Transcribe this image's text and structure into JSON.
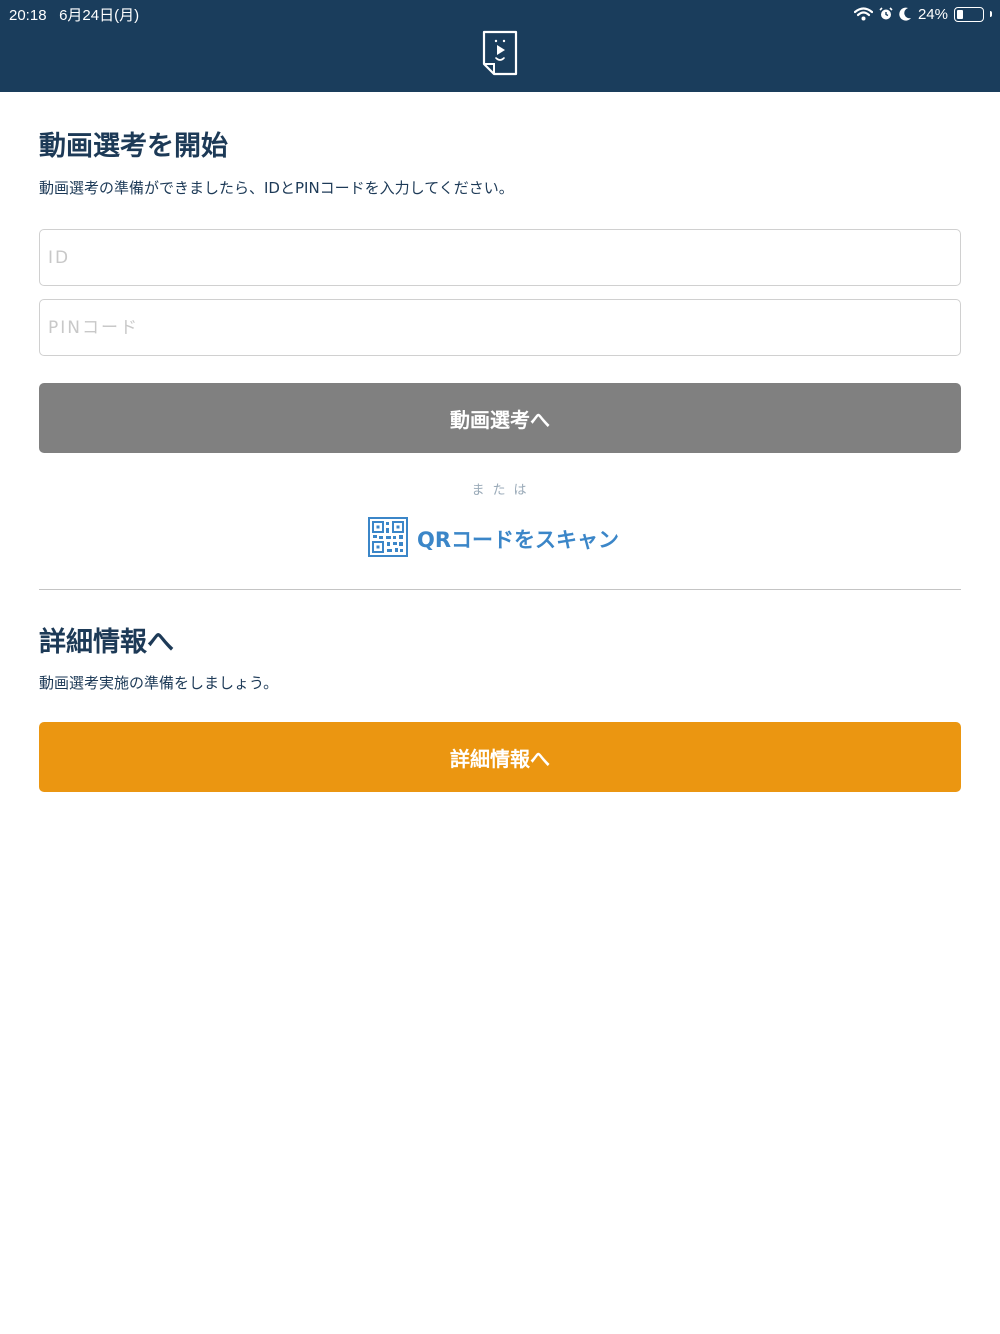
{
  "status_bar": {
    "time": "20:18",
    "date": "6月24日(月)",
    "battery_percent": "24%",
    "battery_level": 0.24,
    "icons": [
      "wifi-icon",
      "alarm-icon",
      "moon-icon",
      "battery-icon"
    ]
  },
  "header": {
    "background_color": "#1a3d5c",
    "logo_icon": "video-document-logo-icon"
  },
  "start_section": {
    "title": "動画選考を開始",
    "description": "動画選考の準備ができましたら、IDとPINコードを入力してください。",
    "id_field": {
      "value": "",
      "placeholder": "ID"
    },
    "pin_field": {
      "value": "",
      "placeholder": "PINコード"
    },
    "submit_label": "動画選考へ",
    "submit_color": "#808080",
    "or_label": "または",
    "qr_label": "QRコードをスキャン",
    "qr_icon": "qr-code-icon",
    "qr_color": "#3b86c8"
  },
  "details_section": {
    "title": "詳細情報へ",
    "description": "動画選考実施の準備をしましょう。",
    "button_label": "詳細情報へ",
    "button_color": "#eb9611"
  }
}
